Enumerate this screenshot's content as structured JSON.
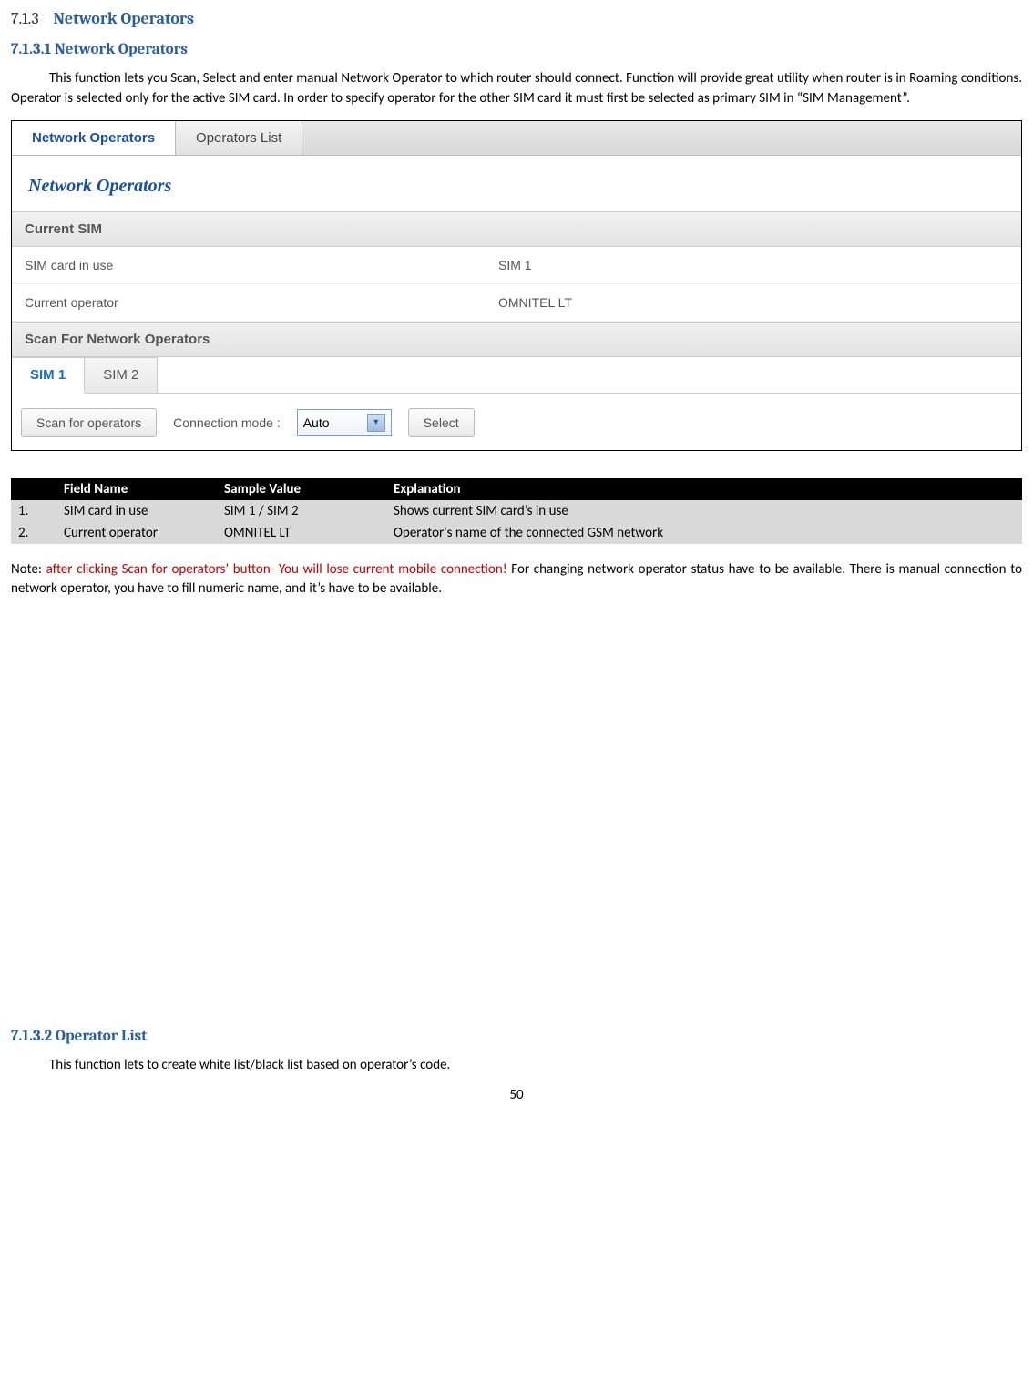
{
  "headings": {
    "h713_num": "7.1.3",
    "h713_title": "Network Operators",
    "h7131": "7.1.3.1    Network Operators",
    "h7132": "7.1.3.2    Operator List"
  },
  "para1": "This function lets you Scan, Select and enter manual Network Operator to which router should connect. Function will provide great utility when router is in Roaming conditions. Operator is selected only for the active SIM card. In order to specify operator for the other SIM card it must first be selected as primary SIM in “SIM Management”.",
  "screenshot": {
    "tabs": [
      "Network Operators",
      "Operators List"
    ],
    "title": "Network Operators",
    "section1": "Current SIM",
    "row1_label": "SIM card in use",
    "row1_value": "SIM 1",
    "row2_label": "Current operator",
    "row2_value": "OMNITEL LT",
    "section2": "Scan For Network Operators",
    "subtabs": [
      "SIM 1",
      "SIM 2"
    ],
    "scan_btn": "Scan for operators",
    "conn_mode_label": "Connection mode :",
    "conn_mode_value": "Auto",
    "select_btn": "Select"
  },
  "table": {
    "headers": [
      "",
      "Field Name",
      "Sample Value",
      "Explanation"
    ],
    "rows": [
      [
        "1.",
        "SIM card in use",
        "SIM 1 / SIM 2",
        "Shows current SIM card’s in use"
      ],
      [
        "2.",
        "Current operator",
        "OMNITEL LT",
        "Operator's name of the connected GSM network"
      ]
    ]
  },
  "note": {
    "prefix": "Note: ",
    "red": "after clicking Scan for operators’ button- You will lose current mobile connection! ",
    "rest": "For changing network operator status have to be available. There is manual connection to network operator, you have to fill numeric name, and it’s have to be available."
  },
  "para2": "This function lets to create white list/black list based on operator’s code.",
  "page_number": "50"
}
